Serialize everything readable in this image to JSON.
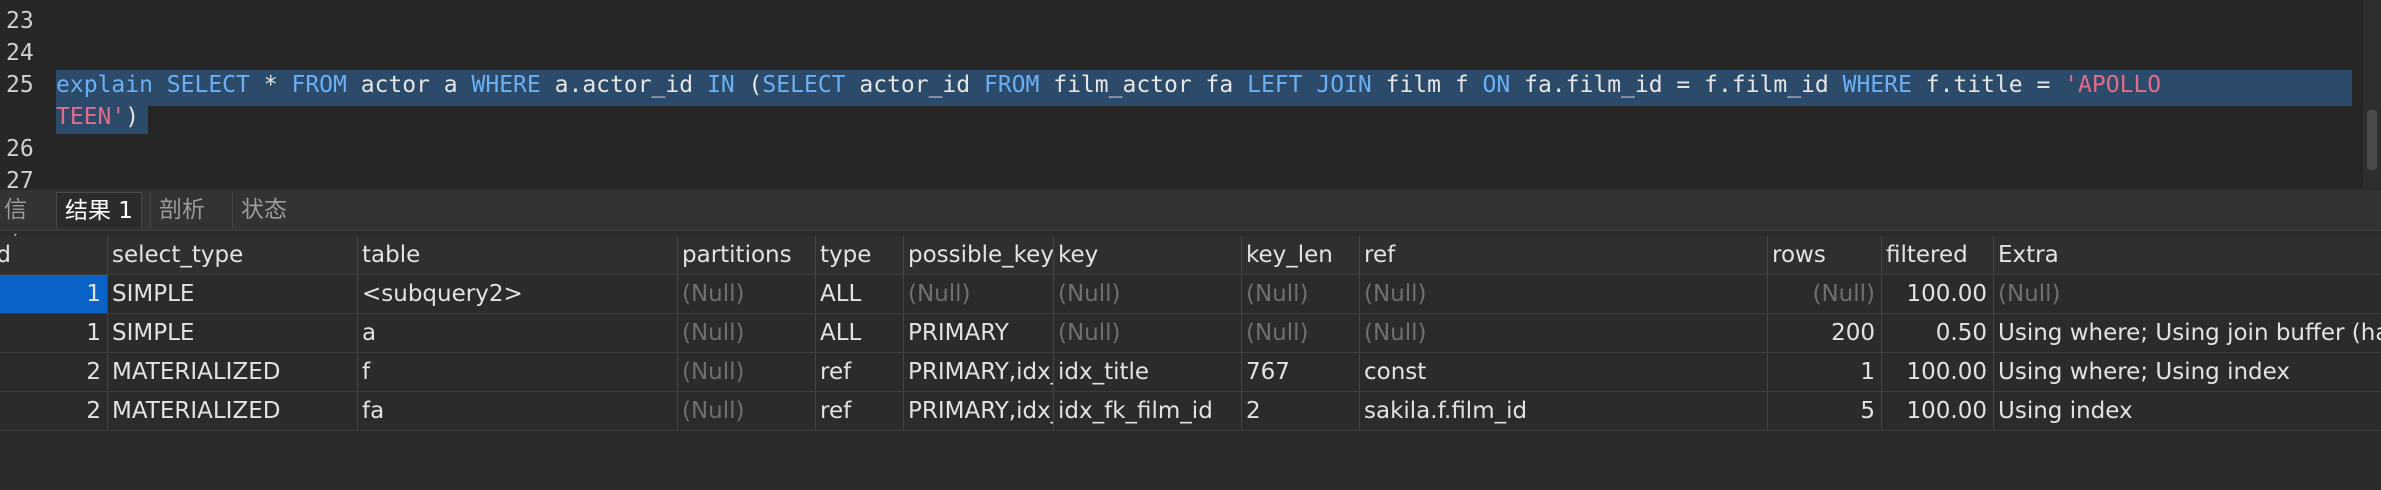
{
  "editor": {
    "lines": [
      {
        "num": "23"
      },
      {
        "num": "24"
      },
      {
        "num": "25"
      },
      {
        "num": "26"
      },
      {
        "num": "27"
      }
    ],
    "query": {
      "p1": "explain",
      "p2": "SELECT",
      "p3": "*",
      "p4": "FROM",
      "p5": "actor a",
      "p6": "WHERE",
      "p7": "a.actor_id",
      "p8": "IN",
      "p9": "(",
      "p10": "SELECT",
      "p11": "actor_id",
      "p12": "FROM",
      "p13": "film_actor fa",
      "p14": "LEFT JOIN",
      "p15": "film f",
      "p16": "ON",
      "p17": "fa.film_id = f.film_id",
      "p18": "WHERE",
      "p19": "f.title =",
      "p20": "'APOLLO",
      "p21": "TEEN'",
      "p22": ")"
    }
  },
  "tabs": [
    {
      "label": "信息"
    },
    {
      "label": "结果 1"
    },
    {
      "label": "剖析"
    },
    {
      "label": "状态"
    }
  ],
  "results": {
    "columns": [
      "id",
      "select_type",
      "table",
      "partitions",
      "type",
      "possible_keys",
      "key",
      "key_len",
      "ref",
      "rows",
      "filtered",
      "Extra"
    ],
    "rows": [
      [
        "1",
        "SIMPLE",
        "<subquery2>",
        "(Null)",
        "ALL",
        "(Null)",
        "(Null)",
        "(Null)",
        "(Null)",
        "(Null)",
        "100.00",
        "(Null)"
      ],
      [
        "1",
        "SIMPLE",
        "a",
        "(Null)",
        "ALL",
        "PRIMARY",
        "(Null)",
        "(Null)",
        "(Null)",
        "200",
        "0.50",
        "Using where; Using join buffer (hash join)"
      ],
      [
        "2",
        "MATERIALIZED",
        "f",
        "(Null)",
        "ref",
        "PRIMARY,idx_title",
        "idx_title",
        "767",
        "const",
        "1",
        "100.00",
        "Using where; Using index"
      ],
      [
        "2",
        "MATERIALIZED",
        "fa",
        "(Null)",
        "ref",
        "PRIMARY,idx_fk_film_id",
        "idx_fk_film_id",
        "2",
        "sakila.f.film_id",
        "5",
        "100.00",
        "Using index"
      ]
    ]
  },
  "colors": {
    "keyword": "#6ab0f3",
    "string": "#e06c8a",
    "selection": "#2c4a6a",
    "selected_cell": "#0a64c8",
    "null_text": "#6f6f6f"
  }
}
